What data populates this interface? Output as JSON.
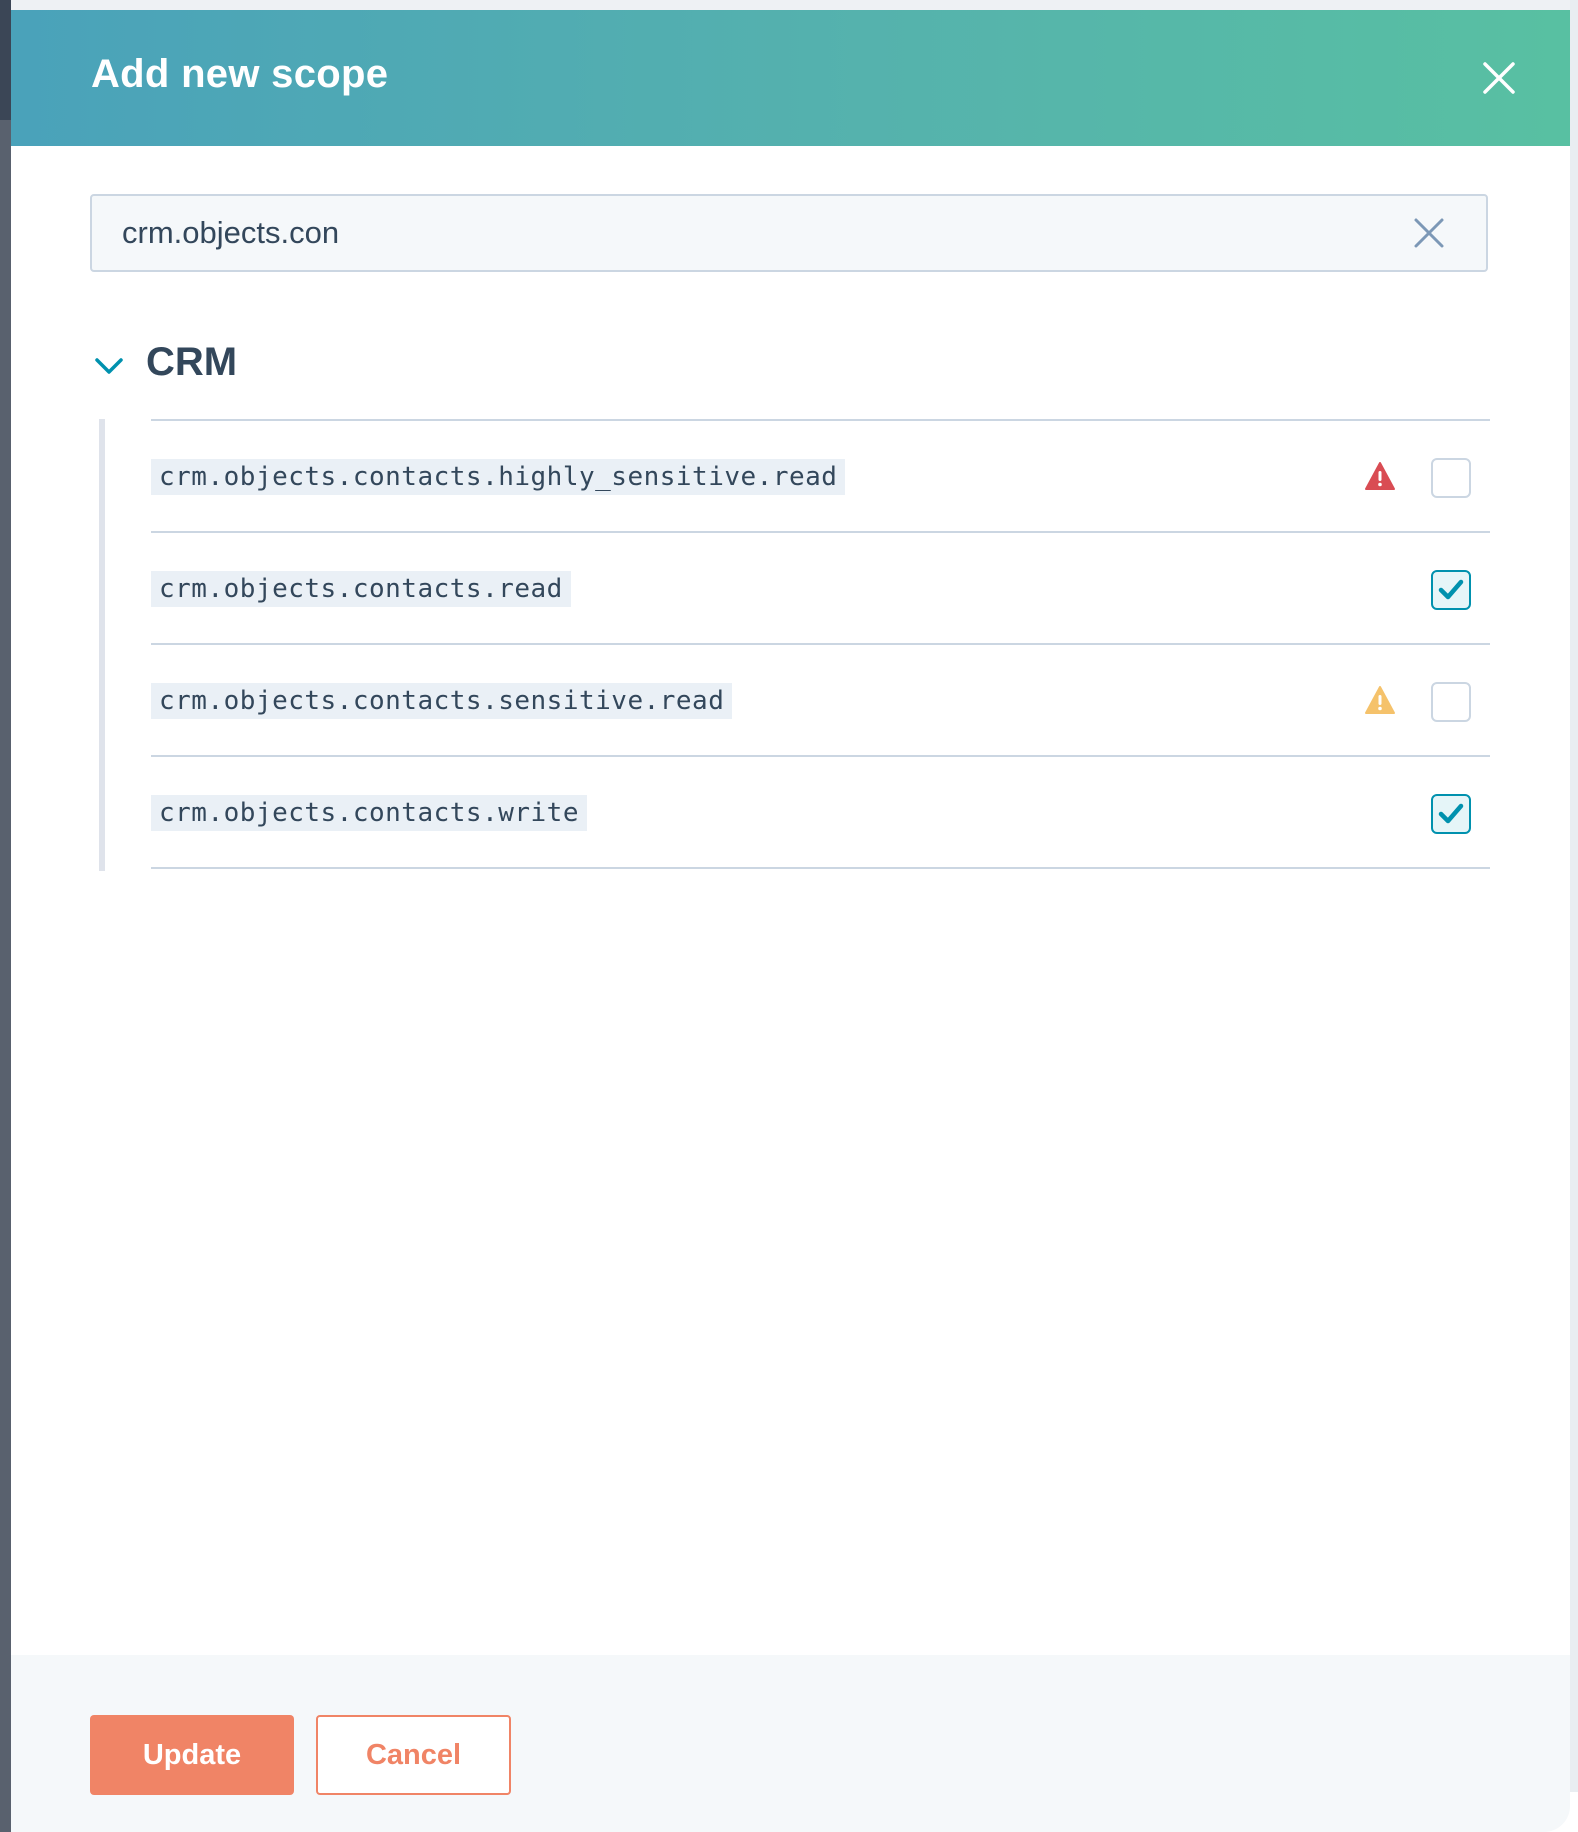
{
  "dialog": {
    "title": "Add new scope",
    "close_icon": "close-icon"
  },
  "search": {
    "value": "crm.objects.con",
    "clear_icon": "clear-icon"
  },
  "group": {
    "title": "CRM",
    "expanded": true,
    "toggle_icon": "chevron-down-icon"
  },
  "scopes": [
    {
      "name": "crm.objects.contacts.highly_sensitive.read",
      "checked": false,
      "warning": "high",
      "warning_icon": "warning-triangle-icon"
    },
    {
      "name": "crm.objects.contacts.read",
      "checked": true,
      "warning": null
    },
    {
      "name": "crm.objects.contacts.sensitive.read",
      "checked": false,
      "warning": "medium",
      "warning_icon": "warning-triangle-icon"
    },
    {
      "name": "crm.objects.contacts.write",
      "checked": true,
      "warning": null
    }
  ],
  "footer": {
    "update_label": "Update",
    "cancel_label": "Cancel"
  },
  "colors": {
    "header_gradient_start": "#4aa2ba",
    "header_gradient_end": "#58c0a2",
    "primary_button": "#f08466",
    "warning_high": "#d94c53",
    "warning_medium": "#f5c26b",
    "checkbox_checked": "#0091ae",
    "text": "#33475b"
  }
}
